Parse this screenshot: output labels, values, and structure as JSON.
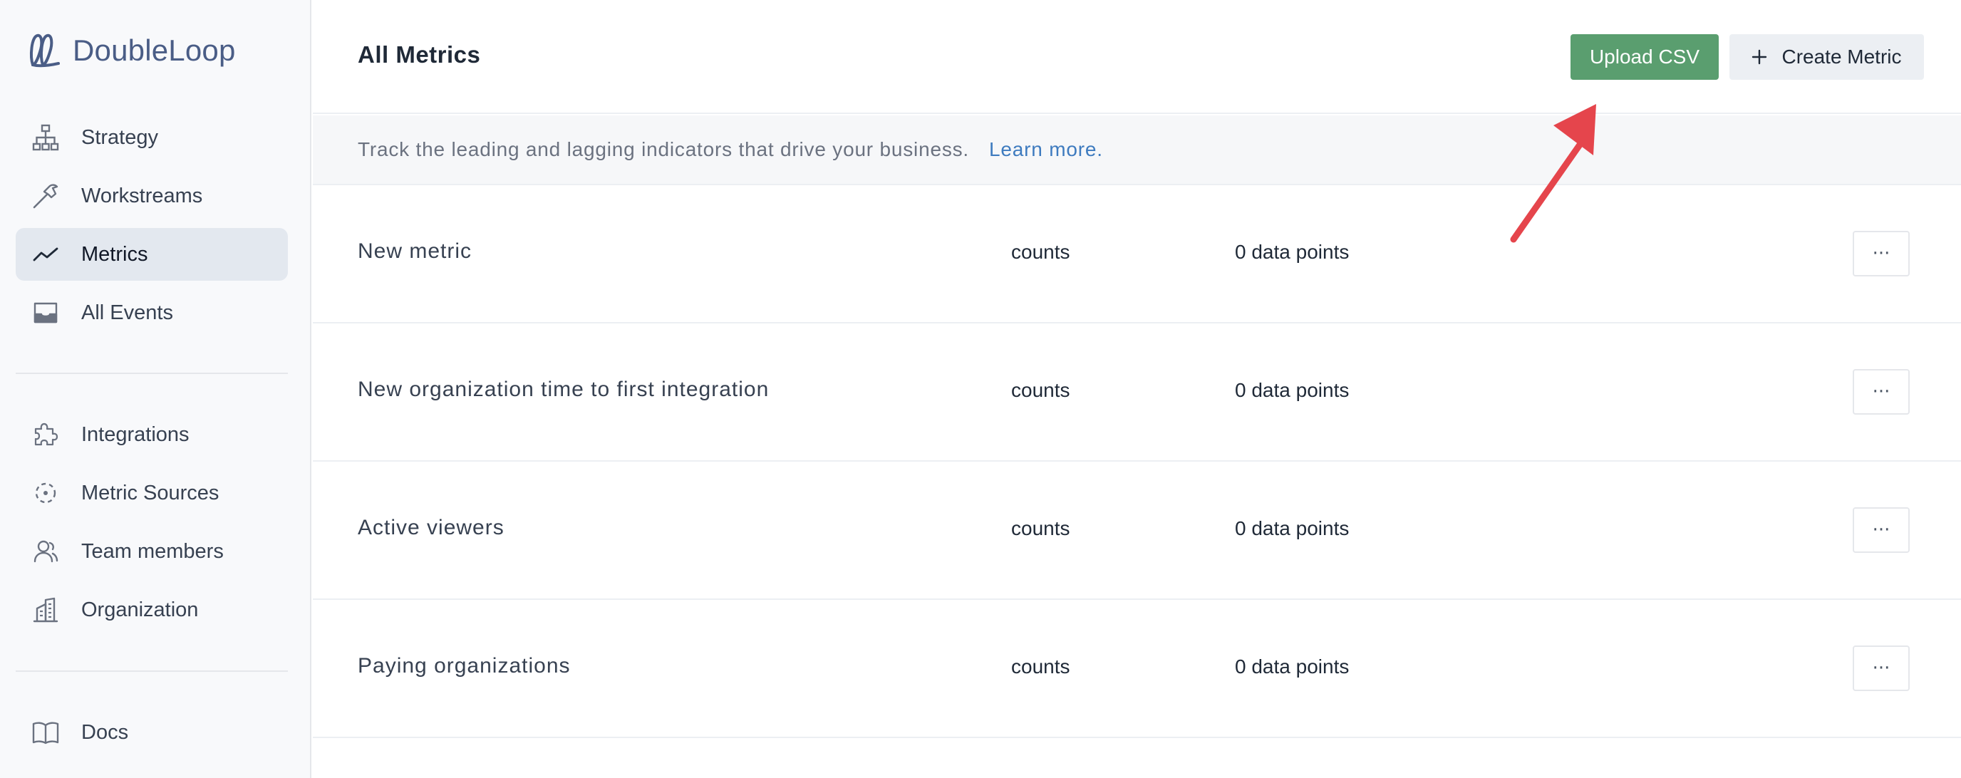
{
  "app": {
    "name": "DoubleLoop"
  },
  "sidebar": {
    "primary": [
      {
        "label": "Strategy",
        "icon": "sitemap-icon"
      },
      {
        "label": "Workstreams",
        "icon": "hammer-icon"
      },
      {
        "label": "Metrics",
        "icon": "trend-line-icon",
        "active": true
      },
      {
        "label": "All Events",
        "icon": "inbox-icon"
      }
    ],
    "secondary": [
      {
        "label": "Integrations",
        "icon": "puzzle-icon"
      },
      {
        "label": "Metric Sources",
        "icon": "data-source-icon"
      },
      {
        "label": "Team members",
        "icon": "team-icon"
      },
      {
        "label": "Organization",
        "icon": "building-icon"
      }
    ],
    "footer": [
      {
        "label": "Docs",
        "icon": "book-icon"
      }
    ]
  },
  "header": {
    "title": "All Metrics",
    "upload_label": "Upload CSV",
    "create_label": "Create Metric"
  },
  "info": {
    "text": "Track the leading and lagging indicators that drive your business.",
    "link": "Learn more."
  },
  "metrics": [
    {
      "name": "New metric",
      "unit": "counts",
      "points": "0 data points",
      "menu": "···"
    },
    {
      "name": "New organization time to first integration",
      "unit": "counts",
      "points": "0 data points",
      "menu": "···"
    },
    {
      "name": "Active viewers",
      "unit": "counts",
      "points": "0 data points",
      "menu": "···"
    },
    {
      "name": "Paying organizations",
      "unit": "counts",
      "points": "0 data points",
      "menu": "···"
    }
  ],
  "colors": {
    "brand": "#4a5d86",
    "upload_button": "#5a9e6f",
    "link": "#3e7bbf",
    "annotation_arrow": "#e5454c",
    "active_nav_bg": "#e3e8ef"
  }
}
